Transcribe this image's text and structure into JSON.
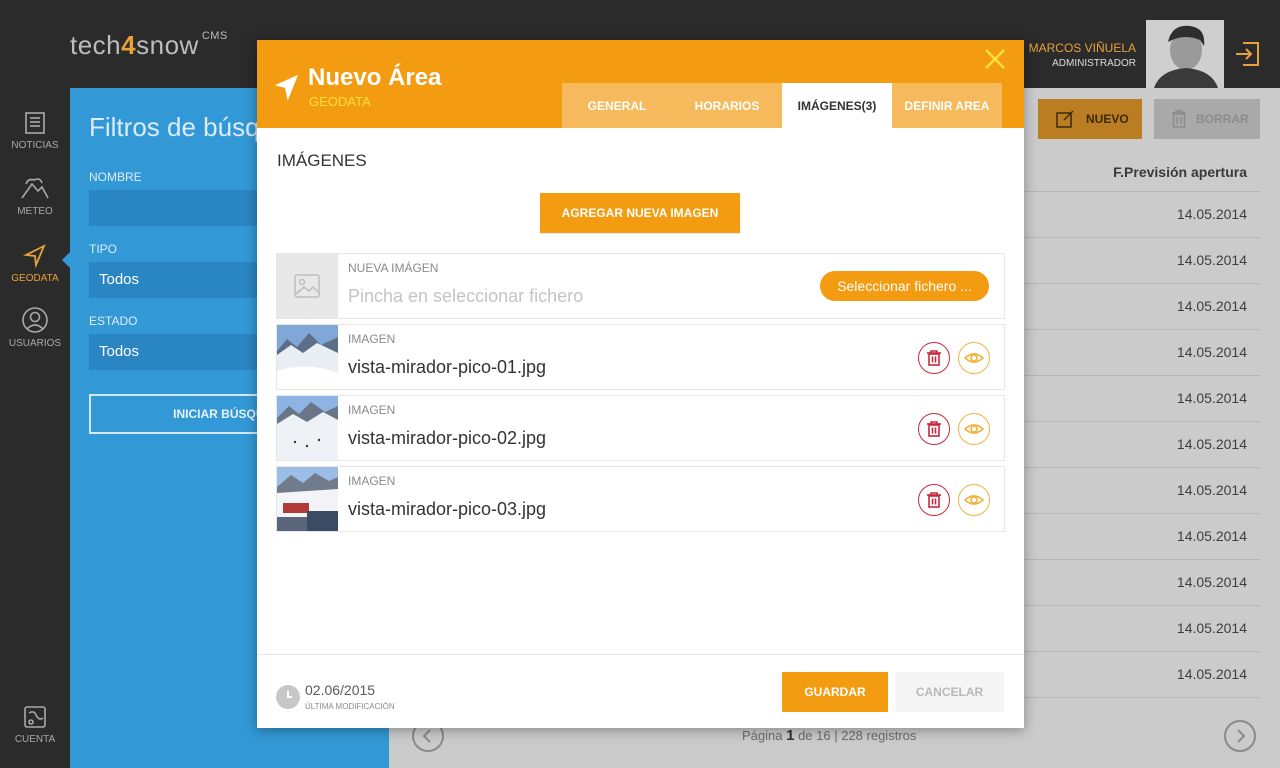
{
  "app": {
    "logo_left": "tech",
    "logo_four": "4",
    "logo_right": "snow",
    "logo_cms": "CMS"
  },
  "user": {
    "name": "MARCOS VIÑUELA",
    "role": "ADMINISTRADOR"
  },
  "sidebar": {
    "items": [
      {
        "label": "NOTICIAS",
        "icon": "newspaper-icon"
      },
      {
        "label": "METEO",
        "icon": "mountain-cloud-icon"
      },
      {
        "label": "GEODATA",
        "icon": "navigation-arrow-icon",
        "active": true
      },
      {
        "label": "USUARIOS",
        "icon": "user-icon"
      },
      {
        "label": "CUENTA",
        "icon": "map-icon"
      }
    ]
  },
  "filters": {
    "title": "Filtros de búsqueda",
    "name_label": "NOMBRE",
    "name_value": "",
    "type_label": "TIPO",
    "type_value": "Todos",
    "state_label": "ESTADO",
    "state_value": "Todos",
    "search_button": "INICIAR BÚSQUEDA"
  },
  "toolbar": {
    "new_label": "NUEVO",
    "delete_label": "BORRAR"
  },
  "table": {
    "column_header": "F.Previsión apertura",
    "rows": [
      "14.05.2014",
      "14.05.2014",
      "14.05.2014",
      "14.05.2014",
      "14.05.2014",
      "14.05.2014",
      "14.05.2014",
      "14.05.2014",
      "14.05.2014",
      "14.05.2014",
      "14.05.2014"
    ]
  },
  "pagination": {
    "prefix": "Página",
    "current": "1",
    "suffix": "de 16 | 228 registros"
  },
  "modal": {
    "title": "Nuevo Área",
    "subtitle": "GEODATA",
    "tabs": [
      "GENERAL",
      "HORARIOS",
      "IMÁGENES(3)",
      "DEFINIR AREA"
    ],
    "active_tab": 2,
    "section_title": "IMÁGENES",
    "add_image_button": "AGREGAR NUEVA IMAGEN",
    "new_image": {
      "label": "NUEVA IMÁGEN",
      "placeholder": "Pincha en seleccionar fichero",
      "select_button": "Seleccionar fichero ..."
    },
    "images": [
      {
        "label": "IMAGEN",
        "filename": "vista-mirador-pico-01.jpg"
      },
      {
        "label": "IMAGEN",
        "filename": "vista-mirador-pico-02.jpg"
      },
      {
        "label": "IMAGEN",
        "filename": "vista-mirador-pico-03.jpg"
      }
    ],
    "footer": {
      "date": "02.06/2015",
      "date_caption": "ÚLTIMA MODIFICACIÓN",
      "save_button": "GUARDAR",
      "cancel_button": "CANCELAR"
    }
  },
  "colors": {
    "accent": "#f39c12",
    "subtitle_yellow": "#ffe03a",
    "filters_blue": "#3398d6",
    "delete_red": "#c62a3d"
  }
}
